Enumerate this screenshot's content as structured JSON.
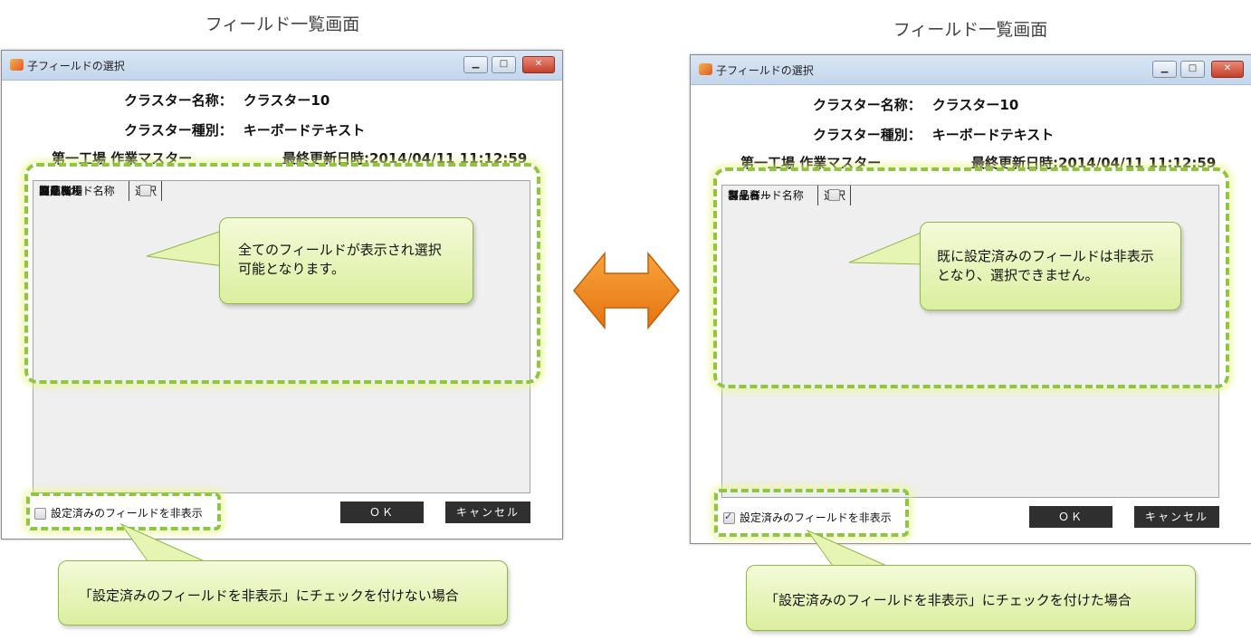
{
  "left": {
    "caption": "フィールド一覧画面",
    "window_title": "子フィールドの選択",
    "cluster_name_label": "クラスター名称：",
    "cluster_name_value": "クラスター10",
    "cluster_type_label": "クラスター種別：",
    "cluster_type_value": "キーボードテキスト",
    "master_name": "第一工場 作業マスター",
    "last_updated": "最終更新日時:2014/04/11 11:12:59",
    "columns": [
      "フィールド名称",
      "選択"
    ],
    "rows": [
      "キー",
      "バリュー",
      "製造工場",
      "図面No.",
      "製品群",
      "適応機種",
      "部品名",
      "客先"
    ],
    "hide_checkbox_label": "設定済みのフィールドを非表示",
    "hide_checked": false,
    "ok_label": "ＯＫ",
    "cancel_label": "キャンセル",
    "callout_table": "全てのフィールドが表示され選択可能となります。",
    "callout_bottom": "「設定済みのフィールドを非表示」にチェックを付けない場合"
  },
  "right": {
    "caption": "フィールド一覧画面",
    "window_title": "子フィールドの選択",
    "cluster_name_label": "クラスター名称：",
    "cluster_name_value": "クラスター10",
    "cluster_type_label": "クラスター種別：",
    "cluster_type_value": "キーボードテキスト",
    "master_name": "第一工場 作業マスター",
    "last_updated": "最終更新日時:2014/04/11 11:12:59",
    "columns": [
      "フィールド名称",
      "選択"
    ],
    "rows": [
      "バリュー",
      "製品群",
      "部品名",
      "客先"
    ],
    "hide_checkbox_label": "設定済みのフィールドを非表示",
    "hide_checked": true,
    "ok_label": "ＯＫ",
    "cancel_label": "キャンセル",
    "callout_table": "既に設定済みのフィールドは非表示となり、選択できません。",
    "callout_bottom": "「設定済みのフィールドを非表示」にチェックを付けた場合"
  },
  "colors": {
    "highlight": "#8dc63f",
    "double_arrow": "#f28a1e",
    "callout_fill": "#dbef9e"
  },
  "icons": [
    "app-icon",
    "minimize-icon",
    "maximize-icon",
    "close-icon",
    "double-arrow-icon"
  ]
}
